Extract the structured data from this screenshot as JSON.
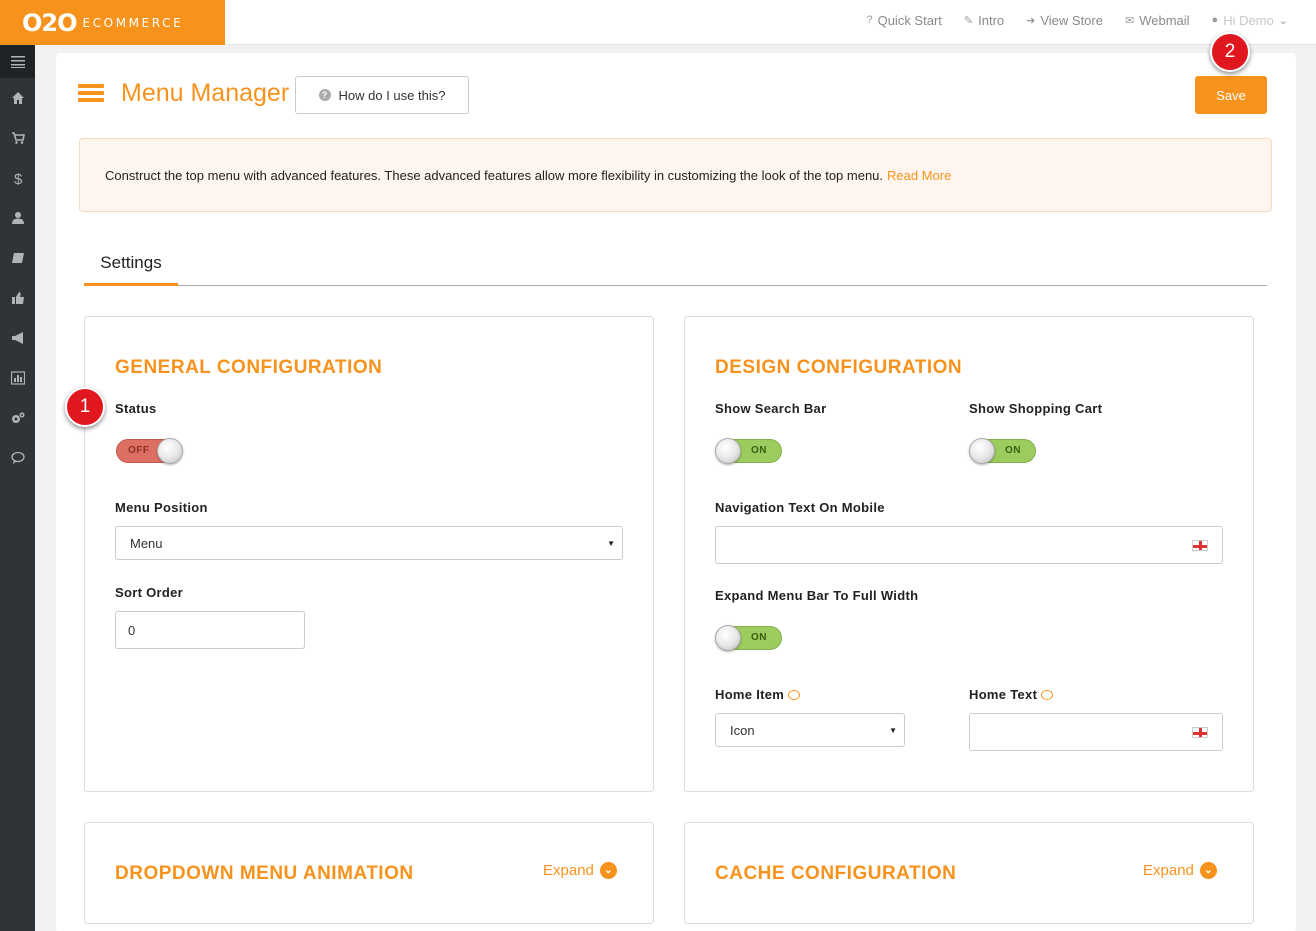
{
  "brand": {
    "logo_main": "O2O",
    "logo_sub": "ECOMMERCE"
  },
  "topnav": {
    "items": [
      {
        "label": "Quick Start",
        "icon": "question-icon"
      },
      {
        "label": "Intro",
        "icon": "pencil-icon"
      },
      {
        "label": "View Store",
        "icon": "signin-icon"
      },
      {
        "label": "Webmail",
        "icon": "envelope-icon"
      }
    ],
    "user": "Hi Demo"
  },
  "sidebar": {
    "items": [
      "menu-icon",
      "home-icon",
      "cart-icon",
      "dollar-icon",
      "user-icon",
      "book-icon",
      "thumbs-up-icon",
      "megaphone-icon",
      "chart-icon",
      "gears-icon",
      "comment-icon"
    ]
  },
  "header": {
    "title": "Menu Manager",
    "help_label": "How do I use this?",
    "save_label": "Save"
  },
  "info": {
    "text": "Construct the top menu with advanced features. These advanced features allow more flexibility in customizing the look of the top menu.",
    "link": "Read More"
  },
  "tabs": [
    {
      "label": "Settings",
      "active": true
    }
  ],
  "general": {
    "title": "GENERAL CONFIGURATION",
    "status_label": "Status",
    "status_value": "OFF",
    "position_label": "Menu Position",
    "position_value": "Menu",
    "sort_label": "Sort Order",
    "sort_value": "0"
  },
  "design": {
    "title": "DESIGN CONFIGURATION",
    "search_label": "Show Search Bar",
    "search_value": "ON",
    "cart_label": "Show Shopping Cart",
    "cart_value": "ON",
    "navtext_label": "Navigation Text On Mobile",
    "navtext_value": "",
    "expand_label": "Expand Menu Bar To Full Width",
    "expand_value": "ON",
    "homeitem_label": "Home Item",
    "homeitem_value": "Icon",
    "hometext_label": "Home Text",
    "hometext_value": ""
  },
  "dropdown": {
    "title": "DROPDOWN MENU ANIMATION",
    "expand": "Expand"
  },
  "cache": {
    "title": "CACHE CONFIGURATION",
    "expand": "Expand"
  },
  "markers": {
    "one": "1",
    "two": "2"
  },
  "colors": {
    "accent": "#f7931d",
    "sidebar": "#2f3438",
    "marker": "#e0171e"
  }
}
